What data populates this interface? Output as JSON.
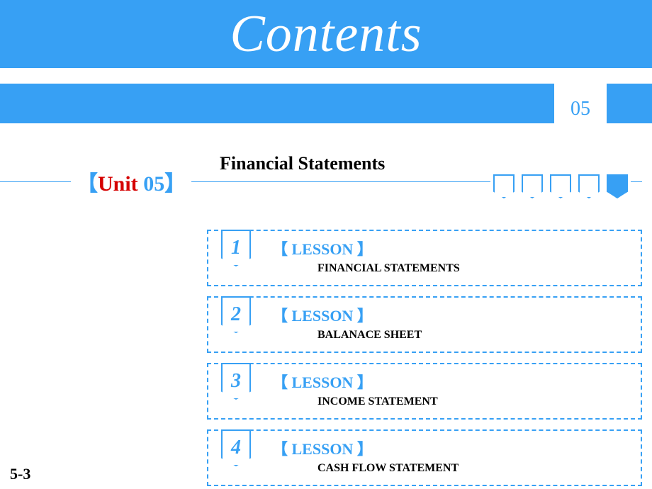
{
  "header": {
    "title": "Contents"
  },
  "badge": {
    "number": "05"
  },
  "unit": {
    "bracket_l": "【",
    "word": "Unit ",
    "num": "05",
    "bracket_r": "】"
  },
  "section": {
    "title": "Financial Statements"
  },
  "progress": {
    "total": 5,
    "filled_index": 4
  },
  "lessons": [
    {
      "num": "1",
      "label": "【 LESSON 】",
      "desc": "FINANCIAL STATEMENTS"
    },
    {
      "num": "2",
      "label": "【 LESSON 】",
      "desc": "BALANACE SHEET"
    },
    {
      "num": "3",
      "label": "【 LESSON 】",
      "desc": "INCOME STATEMENT"
    },
    {
      "num": "4",
      "label": "【 LESSON 】",
      "desc": "CASH FLOW STATEMENT"
    }
  ],
  "page": {
    "number": "5-3"
  }
}
